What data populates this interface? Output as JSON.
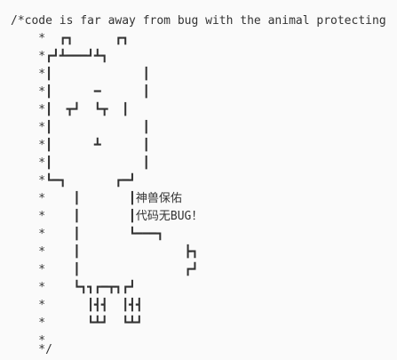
{
  "snippet": {
    "lines": [
      "/*code is far away from bug with the animal protecting",
      "    *  ┏┓      ┏┓",
      "    *┏┛┻━━━┛┻┓",
      "    *┃             ┃",
      "    *┃      ━      ┃",
      "    *┃  ┳┛  ┗┳  ┃",
      "    *┃             ┃",
      "    *┃      ┻      ┃",
      "    *┃             ┃",
      "    *┗━┓       ┏━┛",
      "    *    ┃       ┃神兽保佑",
      "    *    ┃       ┃代码无BUG！",
      "    *    ┃       ┗━━━┓",
      "    *    ┃               ┣┓",
      "    *    ┃               ┏┛",
      "    *    ┗┓┓┏━┳┓┏┛",
      "    *      ┃┫┫  ┃┫┫",
      "    *      ┗┻┛  ┗┻┛",
      "    *",
      "    */"
    ]
  }
}
